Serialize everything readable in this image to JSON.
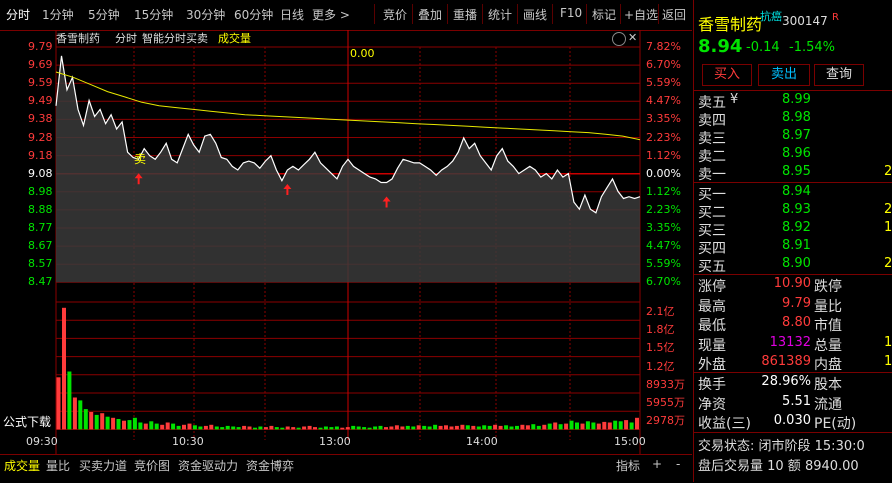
{
  "toolbar": {
    "tabs": [
      "分时",
      "1分钟",
      "5分钟",
      "15分钟",
      "30分钟",
      "60分钟",
      "日线",
      "更多 >"
    ],
    "actions": [
      "竞价",
      "叠加",
      "重播",
      "统计",
      "画线",
      "F10",
      "标记",
      "+自选",
      "返回"
    ]
  },
  "chart_header": {
    "name": "香雪制药",
    "mode": "分时",
    "indicator": "智能分时买卖",
    "volume_label": "成交量",
    "top_value": "0.00"
  },
  "price_axis": {
    "left": [
      "9.79",
      "9.69",
      "9.59",
      "9.49",
      "9.38",
      "9.28",
      "9.18",
      "9.08",
      "8.98",
      "8.88",
      "8.77",
      "8.67",
      "8.57",
      "8.47"
    ],
    "right": [
      "7.82%",
      "6.70%",
      "5.59%",
      "4.47%",
      "3.35%",
      "2.23%",
      "1.12%",
      "0.00%",
      "1.12%",
      "2.23%",
      "3.35%",
      "4.47%",
      "5.59%",
      "6.70%"
    ]
  },
  "volume_axis": [
    "2.1亿",
    "1.8亿",
    "1.5亿",
    "1.2亿",
    "8933万",
    "5955万",
    "2978万"
  ],
  "time_axis": [
    "09:30",
    "10:30",
    "13:00",
    "14:00",
    "15:00"
  ],
  "chart_data": {
    "type": "line",
    "x_range": [
      "09:30",
      "15:00"
    ],
    "y_range": [
      8.47,
      9.79
    ],
    "prev_close": 9.08,
    "series": [
      {
        "values": [
          9.46,
          9.74,
          9.55,
          9.62,
          9.44,
          9.35,
          9.49,
          9.4,
          9.44,
          9.36,
          9.41,
          9.33,
          9.37,
          9.2,
          9.17,
          9.16,
          9.22,
          9.18,
          9.16,
          9.2,
          9.25,
          9.16,
          9.14,
          9.22,
          9.3,
          9.24,
          9.2,
          9.29,
          9.3,
          9.25,
          9.17,
          9.16,
          9.12,
          9.1,
          9.14,
          9.15,
          9.14,
          9.11,
          9.15,
          9.18,
          9.1,
          9.04,
          9.1,
          9.12,
          9.1,
          9.13,
          9.16,
          9.2,
          9.14,
          9.11,
          9.08,
          9.05,
          9.12,
          9.16,
          9.12,
          9.1,
          9.08,
          9.06,
          9.05,
          9.03,
          9.03,
          9.05,
          9.11,
          9.16,
          9.15,
          9.14,
          9.14,
          9.12,
          9.1,
          9.07,
          9.1,
          9.12,
          9.15,
          9.2,
          9.28,
          9.22,
          9.25,
          9.18,
          9.14,
          9.1,
          9.18,
          9.22,
          9.15,
          9.12,
          9.08,
          9.1,
          9.12,
          9.1,
          9.06,
          9.08,
          9.05,
          9.1,
          9.06,
          9.08,
          8.92,
          8.88,
          8.96,
          8.88,
          8.86,
          8.95,
          9.0,
          9.05,
          8.98,
          8.94,
          8.95,
          8.94,
          8.95
        ]
      },
      {
        "values": [
          9.65,
          9.62,
          9.58,
          9.54,
          9.51,
          9.48,
          9.46,
          9.45,
          9.44,
          9.43,
          9.42,
          9.41,
          9.405,
          9.4,
          9.395,
          9.39,
          9.385,
          9.38,
          9.375,
          9.37,
          9.365,
          9.36,
          9.355,
          9.35,
          9.345,
          9.34,
          9.335,
          9.33,
          9.325,
          9.32,
          9.315,
          9.31,
          9.3,
          9.29,
          9.27
        ]
      }
    ],
    "volume": [
      0.9,
      2.1,
      1.0,
      0.55,
      0.5,
      0.35,
      0.3,
      0.25,
      0.28,
      0.22,
      0.2,
      0.18,
      0.15,
      0.16,
      0.2,
      0.12,
      0.1,
      0.14,
      0.1,
      0.08,
      0.12,
      0.1,
      0.06,
      0.08,
      0.1,
      0.07,
      0.05,
      0.06,
      0.08,
      0.05,
      0.04,
      0.06,
      0.05,
      0.04,
      0.06,
      0.05,
      0.03,
      0.05,
      0.04,
      0.06,
      0.04,
      0.03,
      0.05,
      0.04,
      0.03,
      0.05,
      0.06,
      0.04,
      0.03,
      0.05,
      0.04,
      0.05,
      0.03,
      0.04,
      0.06,
      0.05,
      0.04,
      0.03,
      0.05,
      0.06,
      0.04,
      0.05,
      0.07,
      0.05,
      0.06,
      0.05,
      0.07,
      0.06,
      0.05,
      0.08,
      0.06,
      0.07,
      0.05,
      0.06,
      0.08,
      0.07,
      0.06,
      0.05,
      0.07,
      0.06,
      0.08,
      0.06,
      0.07,
      0.05,
      0.06,
      0.08,
      0.07,
      0.09,
      0.06,
      0.08,
      0.1,
      0.12,
      0.09,
      0.1,
      0.15,
      0.12,
      0.1,
      0.14,
      0.12,
      0.1,
      0.13,
      0.12,
      0.15,
      0.14,
      0.16,
      0.12,
      0.2
    ]
  },
  "markers": {
    "sell_label": "卖",
    "buy_arrows": [
      15,
      42,
      60
    ]
  },
  "bottombar": {
    "tabs": [
      "成交量",
      "量比",
      "买卖力道",
      "竞价图",
      "资金驱动力",
      "资金博弈"
    ],
    "indicator_btn": "指标",
    "plus": "+",
    "minus": "-"
  },
  "quote": {
    "name": "香雪制药",
    "tag": "抗癌",
    "code": "300147",
    "badge": "R",
    "price": "8.94",
    "change": "-0.14",
    "pct": "-1.54%",
    "buttons": [
      "买入",
      "卖出",
      "查询"
    ],
    "asks": [
      {
        "label": "卖五",
        "price": "8.99",
        "vol": ""
      },
      {
        "label": "卖四",
        "price": "8.98",
        "vol": ""
      },
      {
        "label": "卖三",
        "price": "8.97",
        "vol": ""
      },
      {
        "label": "卖二",
        "price": "8.96",
        "vol": ""
      },
      {
        "label": "卖一",
        "price": "8.95",
        "vol": "2"
      }
    ],
    "ask_mark": "¥",
    "bids": [
      {
        "label": "买一",
        "price": "8.94",
        "vol": ""
      },
      {
        "label": "买二",
        "price": "8.93",
        "vol": "2"
      },
      {
        "label": "买三",
        "price": "8.92",
        "vol": "1"
      },
      {
        "label": "买四",
        "price": "8.91",
        "vol": ""
      },
      {
        "label": "买五",
        "price": "8.90",
        "vol": "2"
      }
    ],
    "stats": [
      {
        "l1": "涨停",
        "v1": "10.90",
        "l2": "跌停",
        "v2": ""
      },
      {
        "l1": "最高",
        "v1": "9.79",
        "l2": "量比",
        "v2": ""
      },
      {
        "l1": "最低",
        "v1": "8.80",
        "l2": "市值",
        "v2": ""
      },
      {
        "l1": "现量",
        "v1": "13132",
        "l2": "总量",
        "v2": "1"
      },
      {
        "l1": "外盘",
        "v1": "861389",
        "l2": "内盘",
        "v2": "1"
      }
    ],
    "stats2": [
      {
        "l1": "换手",
        "v1": "28.96%",
        "l2": "股本"
      },
      {
        "l1": "净资",
        "v1": "5.51",
        "l2": "流通"
      },
      {
        "l1": "收益(三)",
        "v1": "0.030",
        "l2": "PE(动)"
      }
    ],
    "status_line": "交易状态: 闭市阶段 15:30:0",
    "after_line": "盘后交易量 10 额 8940.00"
  },
  "overlay": {
    "formula_download": "公式下载"
  },
  "colors": {
    "grid": "#8b0000",
    "price_line": "#ffffff",
    "avg_line": "#e8e800",
    "up": "#ff3b3b",
    "down": "#00e400"
  }
}
